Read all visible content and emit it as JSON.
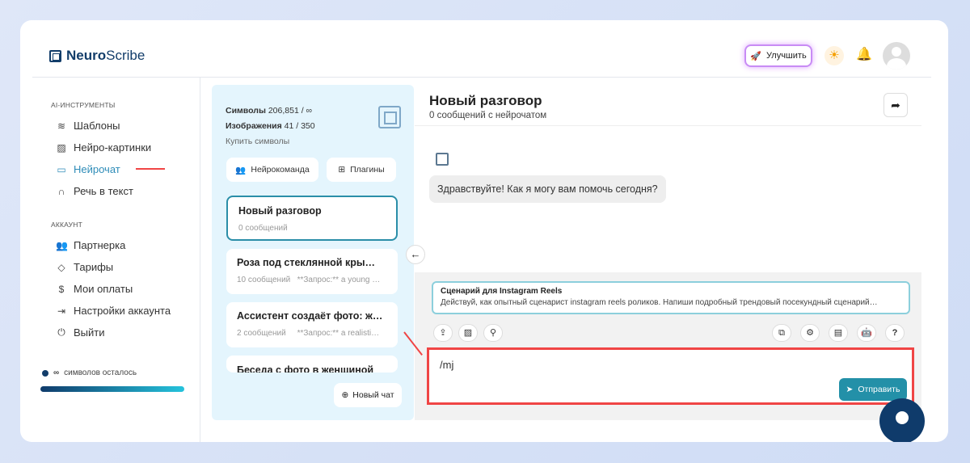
{
  "app": {
    "logo_bold": "Neuro",
    "logo_rest": "Scribe"
  },
  "header": {
    "upgrade_label": "Улучшить"
  },
  "sidebar": {
    "section_tools": "AI-ИНСТРУМЕНТЫ",
    "tools": [
      {
        "label": "Шаблоны"
      },
      {
        "label": "Нейро-картинки"
      },
      {
        "label": "Нейрочат"
      },
      {
        "label": "Речь в текст"
      }
    ],
    "section_account": "АККАУНТ",
    "account": [
      {
        "label": "Партнерка"
      },
      {
        "label": "Тарифы"
      },
      {
        "label": "Мои оплаты"
      },
      {
        "label": "Настройки аккаунта"
      },
      {
        "label": "Выйти"
      }
    ],
    "symbols_left_symbol": "∞",
    "symbols_left_label": "символов осталось",
    "symbols_fill": 1.0
  },
  "panel": {
    "symbols_label": "Символы",
    "symbols_value": "206,851 / ∞",
    "images_label": "Изображения",
    "images_value": "41 / 350",
    "buy_label": "Купить символы",
    "team_button": "Нейрокоманда",
    "plugins_button": "Плагины",
    "chats": [
      {
        "title": "Новый разговор",
        "count": "0 сообщений",
        "preview": ""
      },
      {
        "title": "Роза под стеклянной кры…",
        "count": "10 сообщений",
        "preview": "**Запрос:** a young …"
      },
      {
        "title": "Ассистент создаёт фото: ж…",
        "count": "2 сообщений",
        "preview": "**Запрос:** a realisti…"
      },
      {
        "title": "Беседа с фото в женщиной",
        "count": "",
        "preview": ""
      }
    ],
    "new_chat_button": "Новый чат"
  },
  "chat": {
    "title": "Новый разговор",
    "subtitle": "0 сообщений с нейрочатом",
    "greeting": "Здравствуйте! Как я могу вам помочь сегодня?",
    "template_title": "Сценарий для Instagram Reels",
    "template_desc": "Действуй, как опытный сценарист instagram reels роликов. Напиши подробный трендовый посекундный сценарий…",
    "input_value": "/mj",
    "send_button": "Отправить",
    "help_label": "?"
  }
}
